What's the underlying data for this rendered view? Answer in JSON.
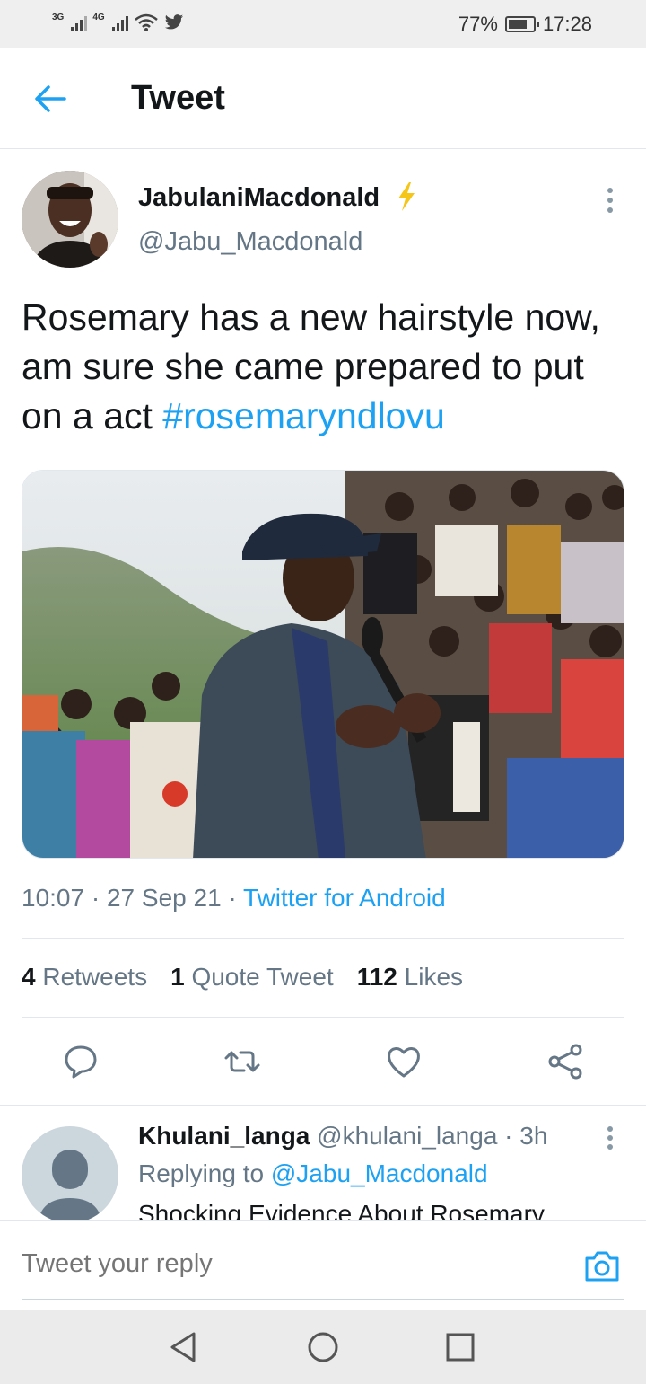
{
  "status_bar": {
    "net1": "3G",
    "net2": "4G",
    "battery_percent": "77%",
    "battery_level": 0.77,
    "time": "17:28",
    "icons": [
      "signal-icon",
      "signal-icon",
      "wifi-icon",
      "twitter-bird-icon",
      "battery-icon"
    ]
  },
  "header": {
    "title": "Tweet",
    "back_icon": "arrow-left-icon"
  },
  "tweet": {
    "author_name": "JabulaniMacdonald",
    "author_handle": "@Jabu_Macdonald",
    "text": "Rosemary has a new hairstyle now, am sure she came prepared to put on a act",
    "hashtag": "#rosemaryndlovu",
    "time": "10:07",
    "date": "27 Sep 21",
    "source": "Twitter for Android",
    "stats": {
      "retweets_count": "4",
      "retweets_label": "Retweets",
      "quotes_count": "1",
      "quotes_label": "Quote Tweet",
      "likes_count": "112",
      "likes_label": "Likes"
    }
  },
  "reply": {
    "author_name": "Khulani_langa",
    "author_handle": "@khulani_langa",
    "age": "3h",
    "replying_label": "Replying to",
    "replying_to": "@Jabu_Macdonald",
    "text": "Shocking Evidence About Rosemary"
  },
  "composer": {
    "placeholder": "Tweet your reply"
  },
  "colors": {
    "accent": "#1da1f2",
    "secondary_text": "#657786",
    "primary_text": "#14171a",
    "bolt": "#f5c518"
  }
}
